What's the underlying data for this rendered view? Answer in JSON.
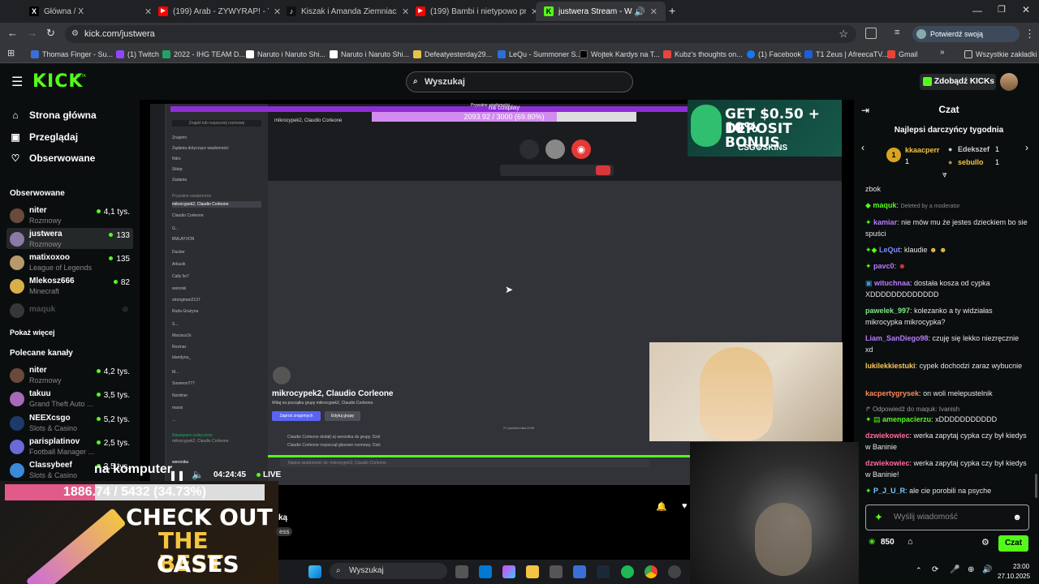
{
  "browser": {
    "tabs": [
      {
        "label": "Główna / X",
        "fav": "X",
        "favColor": "#000"
      },
      {
        "label": "(199) Arab - ŻYWYRAP! - YouTube",
        "fav": "▶",
        "favColor": "#ff0000"
      },
      {
        "label": "Kiszak i Amanda Ziemniaczki: N",
        "fav": "♪",
        "favColor": "#111"
      },
      {
        "label": "(199) Bambi i nietypowo prośba",
        "fav": "▶",
        "favColor": "#ff0000"
      },
      {
        "label": "justwera Stream - Watch Li",
        "fav": "K",
        "favColor": "#53fc18"
      }
    ],
    "url": "kick.com/justwera",
    "identity_button": "Potwierdź swoją tożsamość",
    "bookmarks": [
      "Thomas Finger - Su...",
      "(1) Twitch",
      "2022 - IHG TEAM D...",
      "Naruto i Naruto Shi...",
      "Naruto i Naruto Shi...",
      "Defeatyesterday29...",
      "LeQu - Summoner S...",
      "Wojtek Kardys na T...",
      "Kubz's thoughts on...",
      "(1) Facebook",
      "T1 Zeus | AfreecaTV...",
      "Gmail"
    ],
    "all_bookmarks": "Wszystkie zakładki"
  },
  "kick": {
    "logo": "KICK",
    "beta": "BETA",
    "search_placeholder": "Wyszukaj",
    "kicks_button": "Zdobądź KICKs"
  },
  "sidebar": {
    "nav": [
      {
        "label": "Strona główna",
        "icon": "home-icon"
      },
      {
        "label": "Przeglądaj",
        "icon": "browse-icon"
      },
      {
        "label": "Obserwowane",
        "icon": "heart-icon"
      }
    ],
    "following_title": "Obserwowane",
    "following": [
      {
        "name": "niter",
        "category": "Rozmowy",
        "viewers": "4,1 tys."
      },
      {
        "name": "justwera",
        "category": "Rozmowy",
        "viewers": "133"
      },
      {
        "name": "matixoxoo",
        "category": "League of Legends",
        "viewers": "135"
      },
      {
        "name": "Mlekosz666",
        "category": "Minecraft",
        "viewers": "82"
      },
      {
        "name": "maquk",
        "category": "",
        "viewers": ""
      }
    ],
    "show_more": "Pokaż więcej",
    "recommended_title": "Polecane kanały",
    "recommended": [
      {
        "name": "niter",
        "category": "Rozmowy",
        "viewers": "4,2 tys."
      },
      {
        "name": "takuu",
        "category": "Grand Theft Auto ...",
        "viewers": "3,5 tys."
      },
      {
        "name": "NEEXcsgo",
        "category": "Slots & Casino",
        "viewers": "5,2 tys."
      },
      {
        "name": "parisplatinov",
        "category": "Football Manager ...",
        "viewers": "2,5 tys."
      },
      {
        "name": "Classybeef",
        "category": "Slots & Casino",
        "viewers": "2,5 tys."
      }
    ]
  },
  "stream": {
    "top_progress_label": "2093.92 / 3000 (69.80%)",
    "top_progress_frac": 0.698,
    "top_overlay": "Prywatne wiadomości",
    "cosplay": "na cosplay",
    "group_title": "mikrocypek2, Claudio Corleone",
    "group_sub": "Witaj na początku grupy mikrocypek2, Claudio Corleone.",
    "invite_btn": "Zaproś znajomych",
    "edit_btn": "Edytuj grupę",
    "date_divider": "27 października 2025",
    "sys1": "Claudio Corleone dodał(-a) weronika do grupy. Dziś",
    "sys2": "Claudio Corleone rozpoczął głosowe rozmowy. Dziś",
    "msg_placeholder": "Napisz wiadomość do: mikrocypek2, Claudio Corleone",
    "discord_list": [
      "Znajdź lub rozpocznij rozmowę",
      "Znajomi",
      "Żądania dotyczące wiadomości",
      "Nitro",
      "Sklep",
      "Zadania",
      "Prywatne wiadomości",
      "mikrocypek2, Claudio Corleone",
      "Claudio Corleone",
      "G...",
      "BMLAYVON",
      "Ducker",
      "Arkusik",
      "Cally 5e7",
      "woronki",
      "strongman2137",
      "Ruda Grażyna",
      "S...",
      "Maciasz1k",
      "Rezinar",
      "blandyna_",
      "M...",
      "Soweron777",
      "Nordiner",
      "massi",
      "..."
    ],
    "voice_label": "Nawiązano połączenie",
    "voice_sub": "mikrocypek2, Claudio Corleone",
    "user_name": "weronika",
    "overlay_text": "na komputer",
    "big_progress_label": "1886.74 / 5432 (34.73%)",
    "big_progress_frac": 0.3473,
    "time": "04:24:45",
    "live": "LIVE",
    "partial_a": "ką",
    "partial_b": "ess"
  },
  "ad_top": {
    "line1": "GET $0.50 + 10%",
    "line2": "DEPOSIT BONUS",
    "brand": "CSG⚙SKINS"
  },
  "ad_bottom": {
    "line1": "CHECK OUT",
    "line2": "THE BEST",
    "line3": "CASES"
  },
  "taskbar": {
    "search": "Wyszukaj",
    "time": "23:00",
    "date": "27.10.2025"
  },
  "chat": {
    "title": "Czat",
    "gifters_title": "Najlepsi darczyńcy tygodnia",
    "gifters": [
      {
        "name": "kkaacperr",
        "count": "1"
      },
      {
        "name": "Edekszef",
        "count": "1"
      },
      {
        "name": "sebullo",
        "count": "1"
      }
    ],
    "messages": [
      {
        "user": "",
        "text": "zbok",
        "color": "#e6e6e6"
      },
      {
        "user": "maquk",
        "text": "Deleted by a moderator",
        "color": "#53fc18",
        "deleted": true
      },
      {
        "user": "kamiar",
        "text": "nie mów mu że jestes dzieckiem bo sie spuści",
        "color": "#b77bff"
      },
      {
        "user": "LeQut",
        "text": "klaudie",
        "color": "#7b8cff"
      },
      {
        "user": "pavc0",
        "text": "",
        "color": "#b77bff"
      },
      {
        "user": "wituchnaa",
        "text": "dostała kosza od cypka XDDDDDDDDDDDDD",
        "color": "#b77bff"
      },
      {
        "user": "pawelek_997",
        "text": "kolezanko a ty widziałas mikrocypka mikrocypka?",
        "color": "#7ee787"
      },
      {
        "user": "Liam_SanDiego98",
        "text": "czuję się lekko niezręcznie xd",
        "color": "#b77bff"
      },
      {
        "user": "lukilekkiestuki",
        "text": "cypek dochodzi zaraz wybucnie",
        "color": "#f8c95a"
      },
      {
        "user": "kacpertygrysek",
        "text": "on woli melepustelnik",
        "color": "#ff8a5c"
      },
      {
        "user": "amenpacierzu",
        "text": "xDDDDDDDDDDD",
        "color": "#53fc18",
        "reply": "Odpowiedź do maquk: Ivanish"
      },
      {
        "user": "dzwiekowiec",
        "text": "werka zapytaj cypka czy był kiedys w Baninie",
        "color": "#ff6b9a"
      },
      {
        "user": "dzwiekowiec",
        "text": "werka zapytaj cypka czy był kiedys w Baninie!",
        "color": "#ff6b9a"
      },
      {
        "user": "P_J_U_R",
        "text": "ale cie porobili na psyche",
        "color": "#7bc8ff"
      }
    ],
    "input_placeholder": "Wyślij wiadomość",
    "points": "850",
    "send_button": "Czat"
  }
}
